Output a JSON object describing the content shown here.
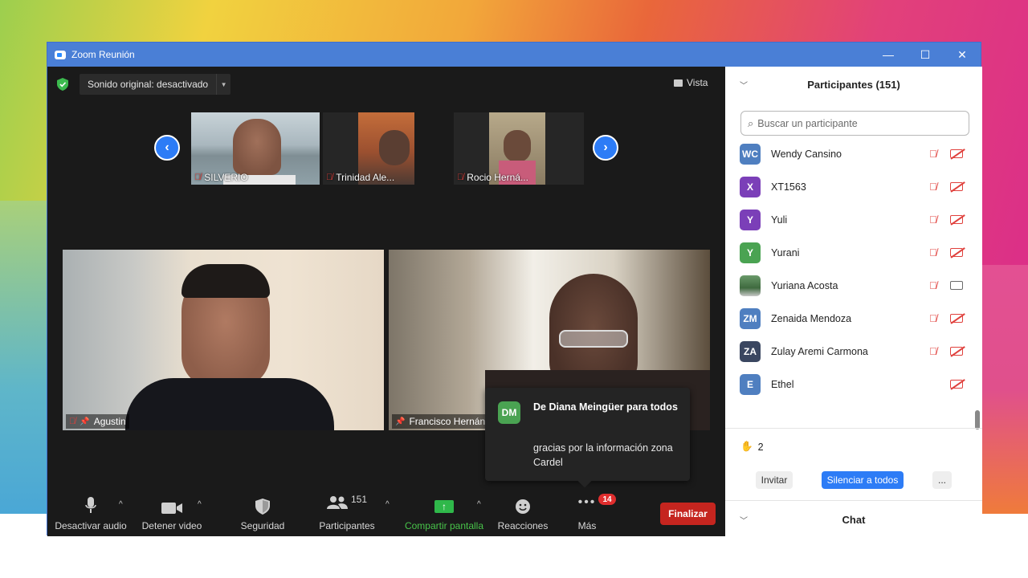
{
  "window": {
    "title": "Zoom Reunión",
    "controls": [
      "—",
      "☐",
      "✕"
    ]
  },
  "top_bar": {
    "sound_label": "Sonido original: desactivado",
    "view_label": "Vista"
  },
  "thumbnails": [
    {
      "name": "SILVERIO"
    },
    {
      "name": "Trinidad Ale..."
    },
    {
      "name": "Rocio Herná..."
    }
  ],
  "tiles": [
    {
      "name": "Agustin"
    },
    {
      "name": "Francisco Hernán"
    }
  ],
  "chat_popup": {
    "avatar": "DM",
    "from": "De Diana Meingüer para todos",
    "message": "gracias por la información zona Cardel"
  },
  "toolbar": {
    "mute": "Desactivar audio",
    "video": "Detener video",
    "security": "Seguridad",
    "participants": "Participantes",
    "participants_count": "151",
    "share": "Compartir pantalla",
    "reactions": "Reacciones",
    "more": "Más",
    "more_badge": "14",
    "end": "Finalizar"
  },
  "panel": {
    "title": "Participantes (151)",
    "search_placeholder": "Buscar un participante",
    "participants": [
      {
        "initials": "WC",
        "name": "Wendy Cansino",
        "color": "#4f7fc0",
        "camera_on": false,
        "mic_icon": true
      },
      {
        "initials": "X",
        "name": "XT1563",
        "color": "#7b3fb8",
        "camera_on": false,
        "mic_icon": true
      },
      {
        "initials": "Y",
        "name": "Yuli",
        "color": "#7b3fb8",
        "camera_on": false,
        "mic_icon": true
      },
      {
        "initials": "Y",
        "name": "Yurani",
        "color": "#4aa352",
        "camera_on": false,
        "mic_icon": true
      },
      {
        "initials": "",
        "name": "Yuriana Acosta",
        "color": "#5a8a5a",
        "camera_on": true,
        "mic_icon": true
      },
      {
        "initials": "ZM",
        "name": "Zenaida Mendoza",
        "color": "#4f7fc0",
        "camera_on": false,
        "mic_icon": true
      },
      {
        "initials": "ZA",
        "name": "Zulay Aremi Carmona",
        "color": "#3a4660",
        "camera_on": false,
        "mic_icon": true
      },
      {
        "initials": "E",
        "name": "Ethel",
        "color": "#4f7fc0",
        "camera_on": false,
        "mic_icon": false
      }
    ],
    "hands_raised": "2",
    "invite": "Invitar",
    "mute_all": "Silenciar a todos",
    "more": "...",
    "chat_title": "Chat"
  },
  "colors": {
    "accent": "#2d7cf6",
    "end": "#c5251f",
    "share": "#2fb84a",
    "muted": "#e0403c"
  }
}
